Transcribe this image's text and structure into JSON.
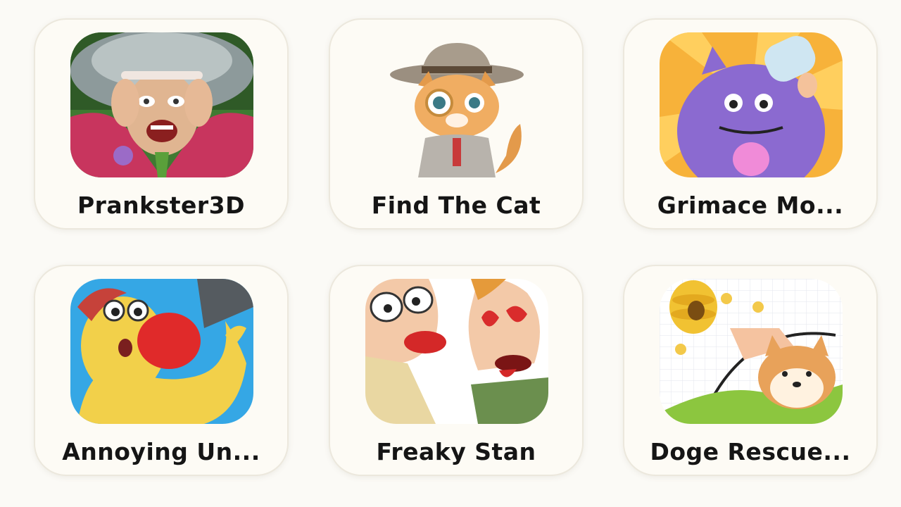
{
  "apps": [
    {
      "name": "Prankster3D",
      "icon": "angry-teacher-icon"
    },
    {
      "name": "Find The Cat",
      "icon": "detective-cat-icon"
    },
    {
      "name": "Grimace Mo...",
      "icon": "purple-monster-icon"
    },
    {
      "name": "Annoying Un...",
      "icon": "boxing-glove-icon"
    },
    {
      "name": "Freaky Stan",
      "icon": "kissing-cartoon-icon"
    },
    {
      "name": "Doge Rescue...",
      "icon": "shiba-dog-bee-icon"
    }
  ],
  "colors": {
    "background": "#fbfaf6",
    "card": "#fdfbf5",
    "text": "#151515"
  }
}
